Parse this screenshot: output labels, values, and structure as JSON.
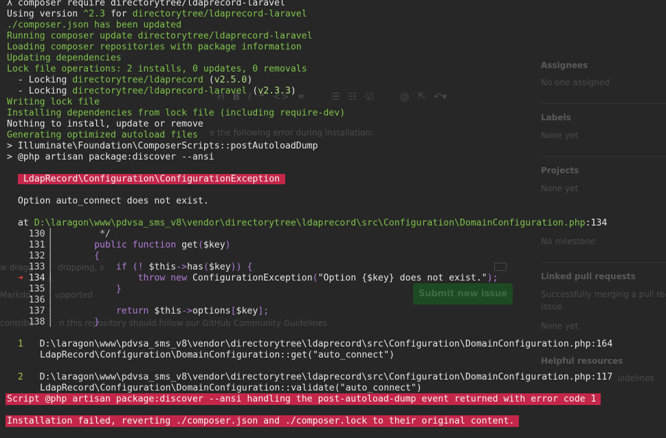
{
  "ghost": {
    "sidebar": {
      "assignees_title": "Assignees",
      "assignees_value": "No one assigned",
      "labels_title": "Labels",
      "labels_value": "None yet",
      "projects_title": "Projects",
      "projects_value": "None yet",
      "milestone_value": "No milestone",
      "linked_title": "Linked pull requests",
      "linked_value_1": "Successfully merging a pull reques",
      "linked_value_2": "issue.",
      "linked_none": "None yet",
      "helpful": "Helpful resources",
      "guidelines": "uidelines"
    },
    "editor": {
      "error_hint": "e the following error during installation:",
      "drag_hint": "w dragg",
      "drag_hint2": "dropping, s",
      "markdown": "Markdo",
      "supported": "upported",
      "contrib": "contribu",
      "contrib2": "n this repository should follow our GitHub Community Guidelines"
    },
    "submit_label": "Submit new issue",
    "toolbar_icons": [
      "H",
      "B",
      "I",
      "quote-icon",
      "code-icon",
      "link-icon",
      "list-icon",
      "ordered-list-icon",
      "tasklist-icon",
      "mention-icon",
      "reference-icon",
      "reply-icon"
    ]
  },
  "terminal": {
    "l01_a": "λ composer require directorytree/ldaprecord-laravel",
    "l02_a": "Using version ",
    "l02_b": "^2.3",
    "l02_c": " for ",
    "l02_d": "directorytree/ldaprecord-laravel",
    "l03": "./composer.json has been updated",
    "l04": "Running composer update directorytree/ldaprecord-laravel",
    "l05": "Loading composer repositories with package information",
    "l06": "Updating dependencies",
    "l07": "Lock file operations: 2 installs, 0 updates, 0 removals",
    "l08_a": "  - Locking ",
    "l08_b": "directorytree/ldaprecord",
    "l08_c": " (",
    "l08_d": "v2.5.0",
    "l08_e": ")",
    "l09_a": "  - Locking ",
    "l09_b": "directorytree/ldaprecord-laravel",
    "l09_c": " (",
    "l09_d": "v2.3.3",
    "l09_e": ")",
    "l10": "Writing lock file",
    "l11": "Installing dependencies from lock file (including require-dev)",
    "l12": "Nothing to install, update or remove",
    "l13": "Generating optimized autoload files",
    "l14": "> Illuminate\\Foundation\\ComposerScripts::postAutoloadDump",
    "l15": "> @php artisan package:discover --ansi",
    "exception": " LdapRecord\\Configuration\\ConfigurationException ",
    "message": "  Option auto_connect does not exist.",
    "at_a": "  at ",
    "at_b": "D:\\laragon\\www\\pdvsa_sms_v8\\vendor\\directorytree\\ldaprecord\\src\\Configuration\\DomainConfiguration.php",
    "at_c": ":134",
    "code": [
      {
        "no": "    130▕",
        "text": "         */"
      },
      {
        "no": "    131▕",
        "text": "        public function get($key)"
      },
      {
        "no": "    132▕",
        "text": "        {"
      },
      {
        "no": "    133▕",
        "text": "            if (! $this->has($key)) {"
      },
      {
        "no": "  ➜ 134▕",
        "text": "                throw new ConfigurationException(\"Option {$key} does not exist.\");"
      },
      {
        "no": "    135▕",
        "text": "            }"
      },
      {
        "no": "    136▕",
        "text": ""
      },
      {
        "no": "    137▕",
        "text": "            return $this->options[$key];"
      },
      {
        "no": "    138▕",
        "text": "        }"
      }
    ],
    "trace1_no": "  1",
    "trace1_path": "D:\\laragon\\www\\pdvsa_sms_v8\\vendor\\directorytree\\ldaprecord\\src\\Configuration\\DomainConfiguration.php:164",
    "trace1_call": "LdapRecord\\Configuration\\DomainConfiguration::get(\"auto_connect\")",
    "trace2_no": "  2",
    "trace2_path": "D:\\laragon\\www\\pdvsa_sms_v8\\vendor\\directorytree\\ldaprecord\\src\\Configuration\\DomainConfiguration.php:117",
    "trace2_call": "LdapRecord\\Configuration\\DomainConfiguration::validate(\"auto_connect\")",
    "err1": "Script @php artisan package:discover --ansi handling the post-autoload-dump event returned with error code 1",
    "err2": "Installation failed, reverting ./composer.json and ./composer.lock to their original content."
  },
  "colors": {
    "background": "#272727",
    "text": "#e6e6e6",
    "green": "#7fc34a",
    "error_banner": "#c4264a",
    "keyword": "#b07cd8"
  }
}
